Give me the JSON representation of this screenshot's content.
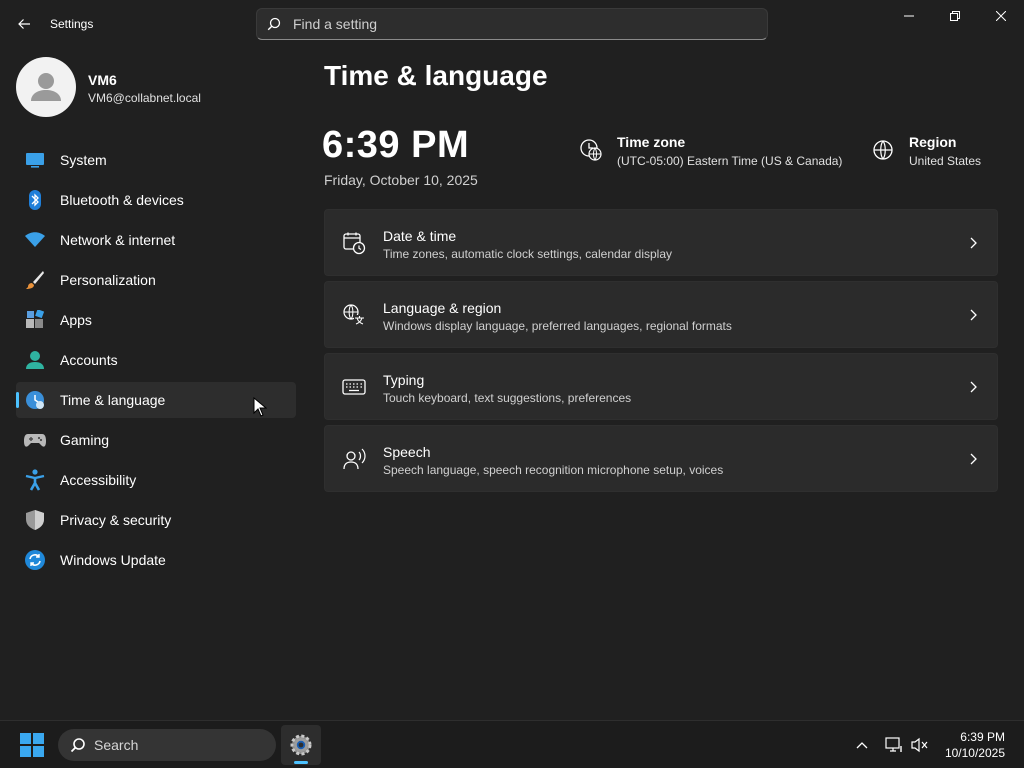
{
  "window": {
    "app_title": "Settings",
    "search_placeholder": "Find a setting"
  },
  "profile": {
    "name": "VM6",
    "email": "VM6@collabnet.local"
  },
  "sidebar": {
    "items": [
      {
        "label": "System",
        "icon": "system-icon"
      },
      {
        "label": "Bluetooth & devices",
        "icon": "bluetooth-icon"
      },
      {
        "label": "Network & internet",
        "icon": "wifi-icon"
      },
      {
        "label": "Personalization",
        "icon": "brush-icon"
      },
      {
        "label": "Apps",
        "icon": "apps-icon"
      },
      {
        "label": "Accounts",
        "icon": "accounts-icon"
      },
      {
        "label": "Time & language",
        "icon": "time-language-icon",
        "selected": true
      },
      {
        "label": "Gaming",
        "icon": "gamepad-icon"
      },
      {
        "label": "Accessibility",
        "icon": "accessibility-icon"
      },
      {
        "label": "Privacy & security",
        "icon": "shield-icon"
      },
      {
        "label": "Windows Update",
        "icon": "update-icon"
      }
    ]
  },
  "main": {
    "page_title": "Time & language",
    "clock": "6:39 PM",
    "date": "Friday, October 10, 2025",
    "time_zone": {
      "title": "Time zone",
      "value": "(UTC-05:00) Eastern Time (US & Canada)"
    },
    "region": {
      "title": "Region",
      "value": "United States"
    },
    "cards": [
      {
        "title": "Date & time",
        "description": "Time zones, automatic clock settings, calendar display",
        "icon": "calendar-clock-icon"
      },
      {
        "title": "Language & region",
        "description": "Windows display language, preferred languages, regional formats",
        "icon": "language-icon"
      },
      {
        "title": "Typing",
        "description": "Touch keyboard, text suggestions, preferences",
        "icon": "keyboard-icon"
      },
      {
        "title": "Speech",
        "description": "Speech language, speech recognition microphone setup, voices",
        "icon": "speech-icon"
      }
    ]
  },
  "taskbar": {
    "search_label": "Search",
    "time": "6:39 PM",
    "date": "10/10/2025"
  },
  "colors": {
    "background": "#202020",
    "card": "#2b2b2b",
    "accent": "#4cc2ff",
    "taskbar": "#1c1c1c"
  }
}
